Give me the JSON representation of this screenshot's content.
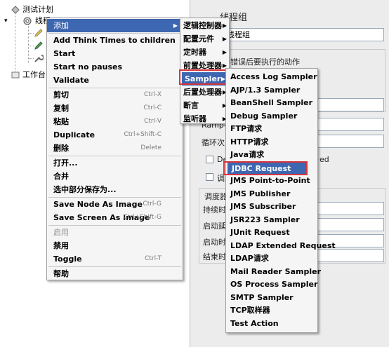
{
  "tree": {
    "root_label": "测试计划",
    "thread_group_label": "线程",
    "workbench_label": "工作台"
  },
  "right_panel": {
    "title": "线程组",
    "name_value": "线程组",
    "error_action_label": "器错误后要执行的动作",
    "ramp_label": "Ramp-U",
    "loop_label": "循环次",
    "delay_label": "Dela",
    "delay_suffix": "ed",
    "scheduler_label": "调度",
    "scheduler_config_label": "调度器",
    "duration_label": "持续时",
    "startup_delay_label": "启动延",
    "start_time_label": "启动时",
    "end_time_label": "结束时"
  },
  "context_menu": {
    "items": [
      {
        "label": "添加",
        "has_submenu": true,
        "highlighted": true
      },
      {
        "label": "Add Think Times to children"
      },
      {
        "label": "Start"
      },
      {
        "label": "Start no pauses"
      },
      {
        "label": "Validate"
      },
      {
        "label": "剪切",
        "shortcut": "Ctrl-X"
      },
      {
        "label": "复制",
        "shortcut": "Ctrl-C"
      },
      {
        "label": "粘贴",
        "shortcut": "Ctrl-V"
      },
      {
        "label": "Duplicate",
        "shortcut": "Ctrl+Shift-C"
      },
      {
        "label": "删除",
        "shortcut": "Delete"
      },
      {
        "label": "打开..."
      },
      {
        "label": "合并"
      },
      {
        "label": "选中部分保存为..."
      },
      {
        "label": "Save Node As Image",
        "shortcut": "Ctrl-G"
      },
      {
        "label": "Save Screen As Image",
        "shortcut": "Ctrl+Shift-G"
      },
      {
        "label": "启用",
        "disabled": true
      },
      {
        "label": "禁用"
      },
      {
        "label": "Toggle",
        "shortcut": "Ctrl-T"
      },
      {
        "label": "帮助"
      }
    ]
  },
  "add_submenu": {
    "items": [
      {
        "label": "逻辑控制器"
      },
      {
        "label": "配置元件"
      },
      {
        "label": "定时器"
      },
      {
        "label": "前置处理器"
      },
      {
        "label": "Sampler",
        "highlighted": true
      },
      {
        "label": "后置处理器"
      },
      {
        "label": "断言"
      },
      {
        "label": "监听器"
      }
    ]
  },
  "sampler_submenu": {
    "items": [
      {
        "label": "Access Log Sampler"
      },
      {
        "label": "AJP/1.3 Sampler"
      },
      {
        "label": "BeanShell Sampler"
      },
      {
        "label": "Debug Sampler"
      },
      {
        "label": "FTP请求"
      },
      {
        "label": "HTTP请求"
      },
      {
        "label": "Java请求"
      },
      {
        "label": "JDBC Request",
        "highlighted": true
      },
      {
        "label": "JMS Point-to-Point"
      },
      {
        "label": "JMS Publisher"
      },
      {
        "label": "JMS Subscriber"
      },
      {
        "label": "JSR223 Sampler"
      },
      {
        "label": "JUnit Request"
      },
      {
        "label": "LDAP Extended Request"
      },
      {
        "label": "LDAP请求"
      },
      {
        "label": "Mail Reader Sampler"
      },
      {
        "label": "OS Process Sampler"
      },
      {
        "label": "SMTP Sampler"
      },
      {
        "label": "TCP取样器"
      },
      {
        "label": "Test Action"
      }
    ]
  },
  "colors": {
    "highlight": "#3d67b1",
    "annotation_red": "#d9343b"
  }
}
